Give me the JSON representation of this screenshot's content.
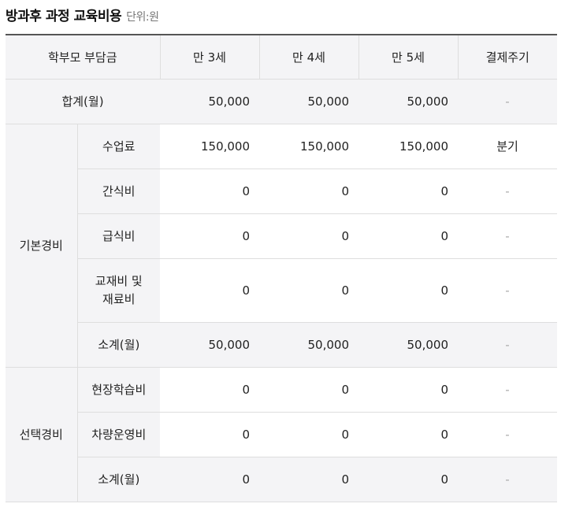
{
  "header": {
    "title": "방과후 과정 교육비용",
    "unit": "단위:원"
  },
  "table": {
    "columns": [
      "학부모 부담금",
      "만 3세",
      "만 4세",
      "만 5세",
      "결제주기"
    ],
    "total_row": {
      "label": "합계(월)",
      "values": [
        "50,000",
        "50,000",
        "50,000"
      ],
      "cycle": "-"
    },
    "basic": {
      "group_label": "기본경비",
      "rows": [
        {
          "label": "수업료",
          "values": [
            "150,000",
            "150,000",
            "150,000"
          ],
          "cycle": "분기"
        },
        {
          "label": "간식비",
          "values": [
            "0",
            "0",
            "0"
          ],
          "cycle": "-"
        },
        {
          "label": "급식비",
          "values": [
            "0",
            "0",
            "0"
          ],
          "cycle": "-"
        },
        {
          "label_line1": "교재비 및",
          "label_line2": "재료비",
          "values": [
            "0",
            "0",
            "0"
          ],
          "cycle": "-"
        },
        {
          "label": "소계(월)",
          "values": [
            "50,000",
            "50,000",
            "50,000"
          ],
          "cycle": "-"
        }
      ]
    },
    "optional": {
      "group_label": "선택경비",
      "rows": [
        {
          "label": "현장학습비",
          "values": [
            "0",
            "0",
            "0"
          ],
          "cycle": "-"
        },
        {
          "label": "차량운영비",
          "values": [
            "0",
            "0",
            "0"
          ],
          "cycle": "-"
        },
        {
          "label": "소계(월)",
          "values": [
            "0",
            "0",
            "0"
          ],
          "cycle": "-"
        }
      ]
    }
  }
}
